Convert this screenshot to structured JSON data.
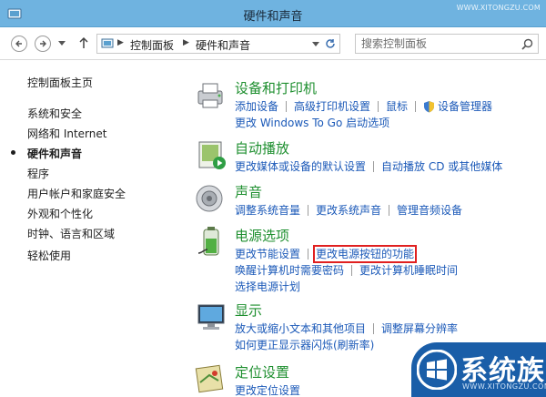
{
  "window": {
    "title": "硬件和声音",
    "watermark_url": "WWW.XITONGZU.COM"
  },
  "address": {
    "crumbs": [
      "控制面板",
      "硬件和声音"
    ],
    "search_placeholder": "搜索控制面板"
  },
  "sidebar": {
    "items": [
      {
        "label": "控制面板主页",
        "active": false
      },
      {
        "label": "系统和安全",
        "active": false
      },
      {
        "label": "网络和 Internet",
        "active": false
      },
      {
        "label": "硬件和声音",
        "active": true
      },
      {
        "label": "程序",
        "active": false
      },
      {
        "label": "用户帐户和家庭安全",
        "active": false
      },
      {
        "label": "外观和个性化",
        "active": false
      },
      {
        "label": "时钟、语言和区域",
        "active": false
      },
      {
        "label": "轻松使用",
        "active": false
      }
    ]
  },
  "categories": [
    {
      "title": "设备和打印机",
      "icon": "printer-icon",
      "rows": [
        [
          "添加设备",
          "高级打印机设置",
          "鼠标",
          "设备管理器"
        ],
        [
          "更改 Windows To Go 启动选项"
        ]
      ]
    },
    {
      "title": "自动播放",
      "icon": "autoplay-icon",
      "rows": [
        [
          "更改媒体或设备的默认设置",
          "自动播放 CD 或其他媒体"
        ]
      ]
    },
    {
      "title": "声音",
      "icon": "speaker-icon",
      "rows": [
        [
          "调整系统音量",
          "更改系统声音",
          "管理音频设备"
        ]
      ]
    },
    {
      "title": "电源选项",
      "icon": "battery-icon",
      "rows": [
        [
          "更改节能设置",
          "更改电源按钮的功能"
        ],
        [
          "唤醒计算机时需要密码",
          "更改计算机睡眠时间"
        ],
        [
          "选择电源计划"
        ]
      ]
    },
    {
      "title": "显示",
      "icon": "display-icon",
      "rows": [
        [
          "放大或缩小文本和其他项目",
          "调整屏幕分辨率"
        ],
        [
          "如何更正显示器闪烁(刷新率)"
        ]
      ]
    },
    {
      "title": "定位设置",
      "icon": "location-icon",
      "rows": [
        [
          "更改定位设置"
        ]
      ]
    }
  ],
  "highlighted_link": "更改电源按钮的功能",
  "watermark": {
    "text": "系统族",
    "url": "WWW.XITONGZU.COM"
  },
  "colors": {
    "titlebar": "#6fb3e0",
    "category_title": "#1e8f2f",
    "link": "#1b59b8",
    "highlight": "#e02020"
  }
}
